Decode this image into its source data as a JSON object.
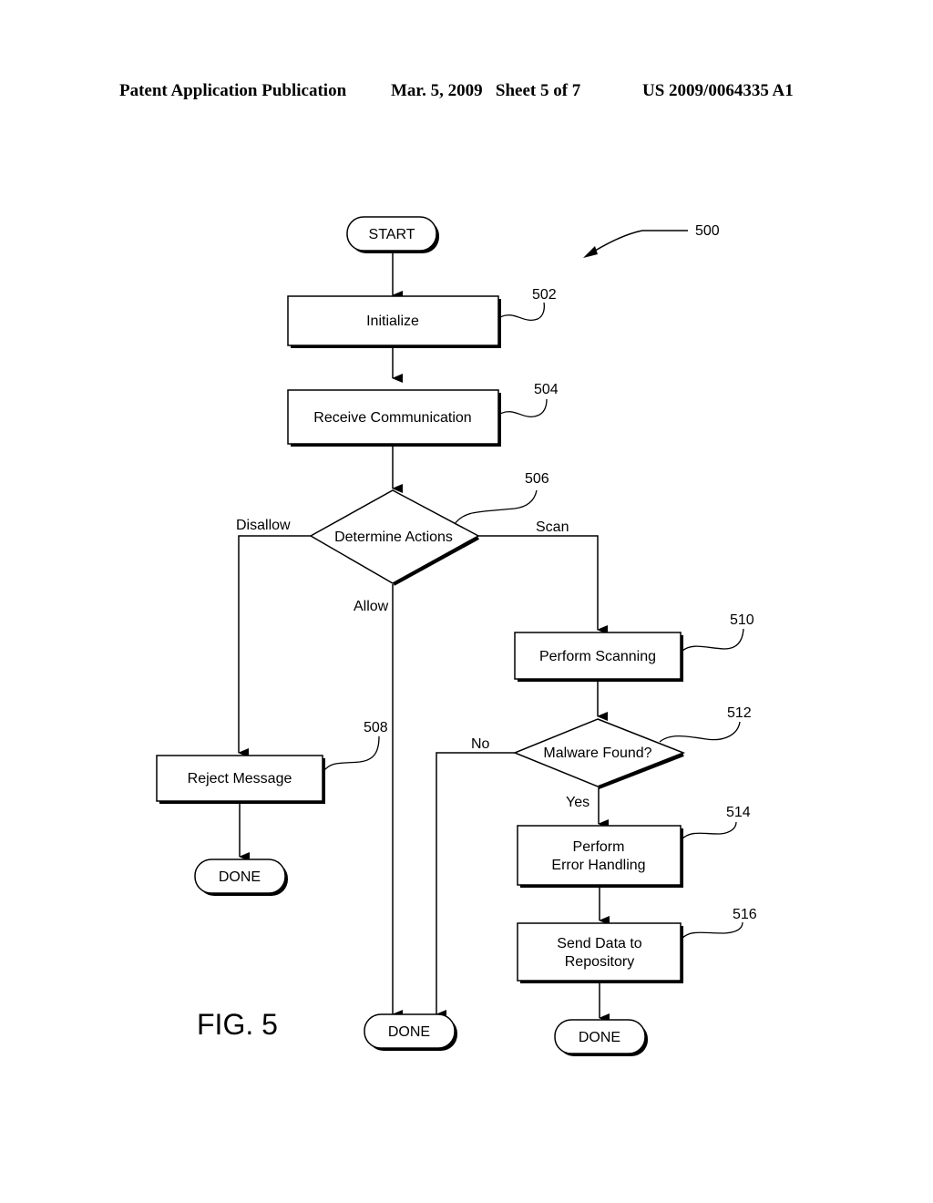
{
  "header": {
    "publication": "Patent Application Publication",
    "date_sheet": "Mar. 5, 2009   Sheet 5 of 7",
    "patent_number": "US 2009/0064335 A1"
  },
  "figure": {
    "label": "FIG. 5",
    "ref": "500"
  },
  "nodes": {
    "start": {
      "text": "START"
    },
    "initialize": {
      "text": "Initialize",
      "ref": "502"
    },
    "receive": {
      "text": "Receive Communication",
      "ref": "504"
    },
    "determine": {
      "text": "Determine Actions",
      "ref": "506"
    },
    "reject": {
      "text": "Reject Message",
      "ref": "508"
    },
    "scanning": {
      "text": "Perform Scanning",
      "ref": "510"
    },
    "malware": {
      "text": "Malware Found?",
      "ref": "512"
    },
    "error": {
      "line1": "Perform",
      "line2": "Error Handling",
      "ref": "514"
    },
    "send": {
      "line1": "Send Data to",
      "line2": "Repository",
      "ref": "516"
    },
    "done_left": {
      "text": "DONE"
    },
    "done_middle": {
      "text": "DONE"
    },
    "done_right": {
      "text": "DONE"
    }
  },
  "edges": {
    "disallow": "Disallow",
    "scan": "Scan",
    "allow": "Allow",
    "no": "No",
    "yes": "Yes"
  }
}
